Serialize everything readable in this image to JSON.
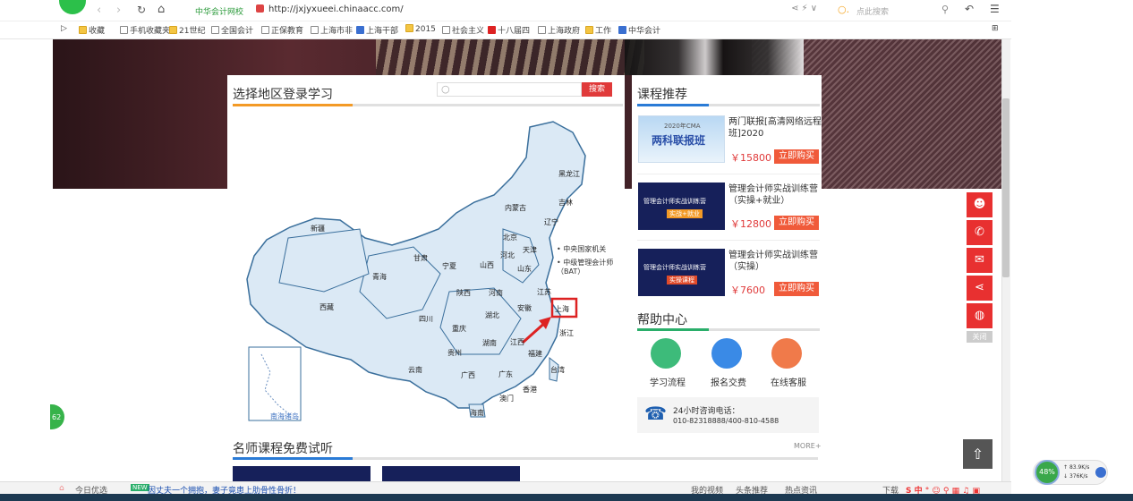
{
  "browser": {
    "url": "http://jxjyxueei.chinaacc.com/",
    "site_badge": "中华会计网校",
    "search_placeholder": "点此搜索"
  },
  "bookmarks": [
    "收藏",
    "手机收藏夹",
    "21世纪",
    "全国会计",
    "正保教育",
    "上海市非",
    "上海干部",
    "2015",
    "社会主义",
    "十八届四",
    "上海政府",
    "工作",
    "中华会计"
  ],
  "region": {
    "title": "选择地区登录学习",
    "search_button": "搜索",
    "provinces": [
      "黑龙江",
      "吉林",
      "辽宁",
      "内蒙古",
      "北京",
      "天津",
      "河北",
      "新疆",
      "甘肃",
      "宁夏",
      "山西",
      "山东",
      "青海",
      "陕西",
      "河南",
      "江苏",
      "西藏",
      "四川",
      "湖北",
      "安徽",
      "上海",
      "重庆",
      "贵州",
      "湖南",
      "江西",
      "浙江",
      "福建",
      "云南",
      "广西",
      "广东",
      "台湾",
      "香港",
      "澳门",
      "海南",
      "南海诸岛"
    ],
    "special_links": [
      "中央国家机关",
      "中级管理会计师（BAT）"
    ]
  },
  "courses": {
    "title": "课程推荐",
    "items": [
      {
        "title": "两门联报[高清网络远程班]2020",
        "price": "￥15800",
        "buy": "立即购买",
        "img_text": "两科联报班",
        "img_sub": "2020年CMA"
      },
      {
        "title": "管理会计师实战训练营（实操+就业）",
        "price": "￥12800",
        "buy": "立即购买",
        "img_text": "管理会计师实战训练营",
        "img_sub": "实战+就业"
      },
      {
        "title": "管理会计师实战训练营（实操）",
        "price": "￥7600",
        "buy": "立即购买",
        "img_text": "管理会计师实战训练营",
        "img_sub": "实操课程"
      }
    ]
  },
  "help": {
    "title": "帮助中心",
    "items": [
      "学习流程",
      "报名交费",
      "在线客服"
    ],
    "hotline_label": "24小时咨询电话：",
    "hotline": "010-82318888/400-810-4588"
  },
  "trial": {
    "title": "名师课程免费试听",
    "more": "MORE+"
  },
  "side": {
    "close": "关闭"
  },
  "statusbar": {
    "today": "今日优选",
    "news": "因丈夫一个拥抱，妻子竟患上肋骨性骨折！",
    "items": [
      "我的视频",
      "头条推荐",
      "热点资讯",
      "下载"
    ]
  },
  "net": {
    "percent": "48%",
    "up": "83.9K/s",
    "down": "376K/s"
  },
  "float_badge": "62",
  "colors": {
    "accent": "#e03a3a",
    "orange_tab": "#f39a26",
    "blue_tab": "#2a7bd6",
    "map_fill": "#dbe9f5",
    "map_stroke": "#3a6f9c"
  }
}
